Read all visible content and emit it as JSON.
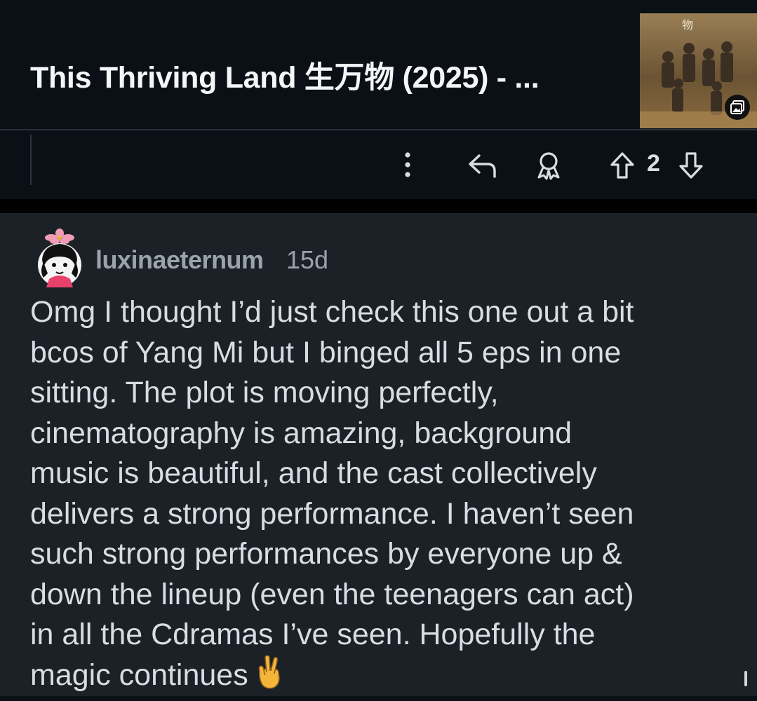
{
  "post": {
    "title": "This Thriving Land 生万物 (2025) - ...",
    "thumbnail_icon": "gallery-icon",
    "vote_count": "2"
  },
  "actions": {
    "more_icon": "more-vertical-icon",
    "reply_icon": "reply-icon",
    "award_icon": "award-icon",
    "upvote_icon": "upvote-icon",
    "downvote_icon": "downvote-icon"
  },
  "comment": {
    "username": "luxinaeternum",
    "time": "15d",
    "body": "Omg I thought I’d just check this one out a bit\nbcos of Yang Mi but I binged all 5 eps in one\nsitting. The plot is moving perfectly,\ncinematography is amazing, background\nmusic is beautiful, and the cast collectively\ndelivers a strong performance. I haven’t seen\nsuch strong performances by everyone up &\ndown the lineup (even the teenagers can act)\nin all the Cdramas I’ve seen. Hopefully the\nmagic continues",
    "emoji_icon": "crossed-fingers-icon"
  },
  "colors": {
    "background": "#0b1016",
    "comment_background": "#1b2127",
    "text": "#d6dde3",
    "muted": "#9aa3ab"
  }
}
